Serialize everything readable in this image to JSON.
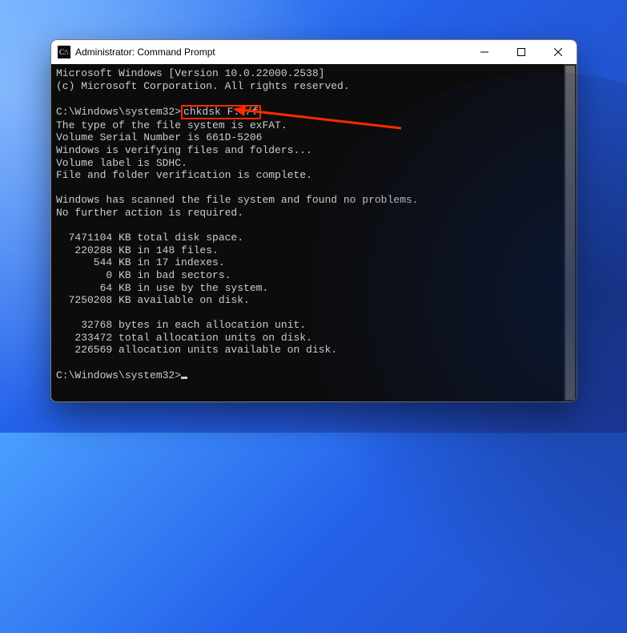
{
  "window": {
    "title": "Administrator: Command Prompt"
  },
  "terminal": {
    "header1": "Microsoft Windows [Version 10.0.22000.2538]",
    "header2": "(c) Microsoft Corporation. All rights reserved.",
    "prompt1_prefix": "C:\\Windows\\system32>",
    "prompt1_cmd": "chkdsk F: /f",
    "line1": "The type of the file system is exFAT.",
    "line2": "Volume Serial Number is 661D-5206",
    "line3": "Windows is verifying files and folders...",
    "line4": "Volume label is SDHC.",
    "line5": "File and folder verification is complete.",
    "line6": "Windows has scanned the file system and found no problems.",
    "line7": "No further action is required.",
    "stat1": "  7471104 KB total disk space.",
    "stat2": "   220288 KB in 148 files.",
    "stat3": "      544 KB in 17 indexes.",
    "stat4": "        0 KB in bad sectors.",
    "stat5": "       64 KB in use by the system.",
    "stat6": "  7250208 KB available on disk.",
    "stat7": "    32768 bytes in each allocation unit.",
    "stat8": "   233472 total allocation units on disk.",
    "stat9": "   226569 allocation units available on disk.",
    "prompt2": "C:\\Windows\\system32>"
  }
}
